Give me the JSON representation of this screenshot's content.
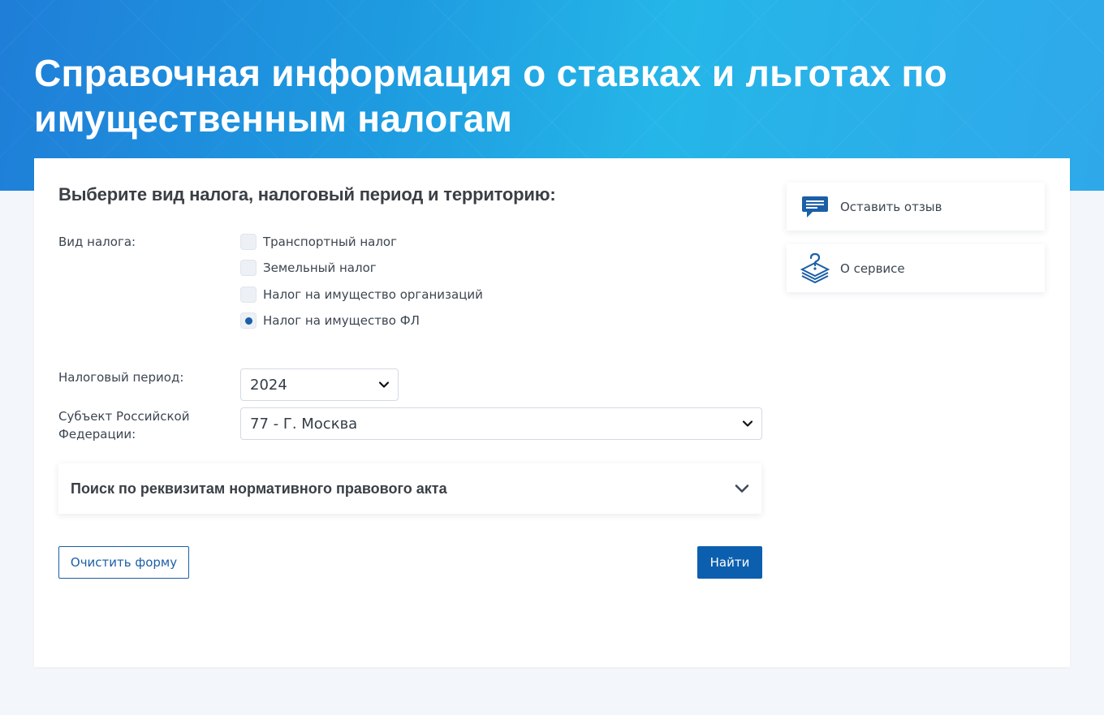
{
  "header": {
    "title": "Справочная информация о ставках и льготах по имущественным налогам"
  },
  "form": {
    "heading": "Выберите вид налога, налоговый период и территорию:",
    "tax_type_label": "Вид налога:",
    "tax_types": [
      {
        "label": "Транспортный налог",
        "selected": false
      },
      {
        "label": "Земельный налог",
        "selected": false
      },
      {
        "label": "Налог на имущество организаций",
        "selected": false
      },
      {
        "label": "Налог на имущество ФЛ",
        "selected": true
      }
    ],
    "period_label": "Налоговый период:",
    "period_value": "2024",
    "region_label_line1": "Субъект Российской",
    "region_label_line2": "Федерации:",
    "region_value": "77 - Г. Москва",
    "accordion_title": "Поиск по реквизитам нормативного правового акта",
    "clear_button": "Очистить форму",
    "find_button": "Найти"
  },
  "sidebar": {
    "feedback": {
      "label": "Оставить отзыв",
      "icon": "comment-icon"
    },
    "about": {
      "label": "О сервисе",
      "icon": "question-stack-icon"
    }
  },
  "colors": {
    "accent": "#0c5fae",
    "header_gradient_start": "#1f7ed8",
    "header_gradient_end": "#2fa8ea"
  }
}
